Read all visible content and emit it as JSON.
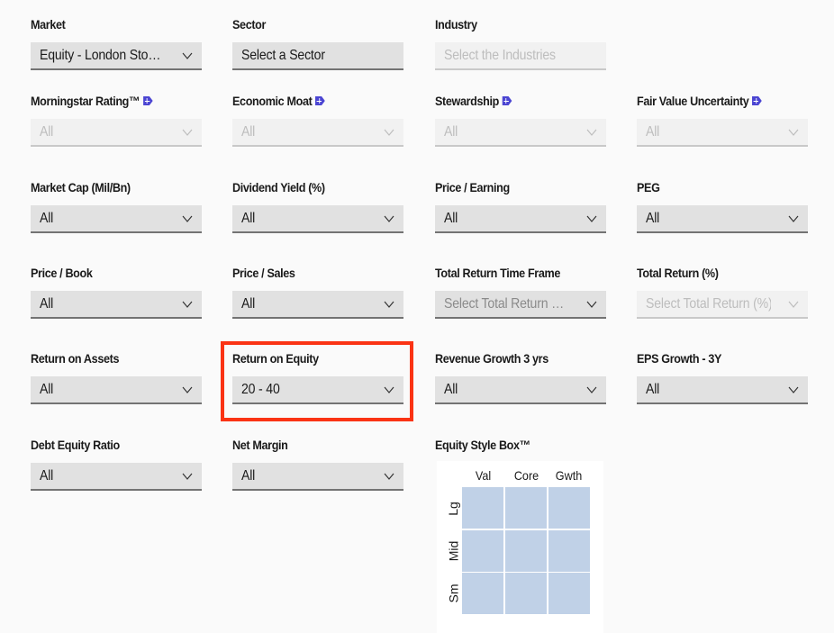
{
  "filters": {
    "market": {
      "label": "Market",
      "value": "Equity - London Sto…"
    },
    "sector": {
      "label": "Sector",
      "value": "Select a Sector"
    },
    "industry": {
      "label": "Industry",
      "placeholder": "Select the Industries"
    },
    "morningstar_rating": {
      "label": "Morningstar Rating™",
      "value": "All"
    },
    "economic_moat": {
      "label": "Economic Moat",
      "value": "All"
    },
    "stewardship": {
      "label": "Stewardship",
      "value": "All"
    },
    "fair_value_uncertainty": {
      "label": "Fair Value Uncertainty",
      "value": "All"
    },
    "market_cap": {
      "label": "Market Cap (Mil/Bn)",
      "value": "All"
    },
    "dividend_yield": {
      "label": "Dividend Yield (%)",
      "value": "All"
    },
    "price_earning": {
      "label": "Price / Earning",
      "value": "All"
    },
    "peg": {
      "label": "PEG",
      "value": "All"
    },
    "price_book": {
      "label": "Price / Book",
      "value": "All"
    },
    "price_sales": {
      "label": "Price / Sales",
      "value": "All"
    },
    "total_return_time_frame": {
      "label": "Total Return Time Frame",
      "placeholder": "Select Total Return …"
    },
    "total_return": {
      "label": "Total Return (%)",
      "placeholder": "Select Total Return (%)"
    },
    "return_on_assets": {
      "label": "Return on Assets",
      "value": "All"
    },
    "return_on_equity": {
      "label": "Return on Equity",
      "value": "20 - 40"
    },
    "revenue_growth_3yrs": {
      "label": "Revenue Growth 3 yrs",
      "value": "All"
    },
    "eps_growth_3y": {
      "label": "EPS Growth - 3Y",
      "value": "All"
    },
    "debt_equity_ratio": {
      "label": "Debt Equity Ratio",
      "value": "All"
    },
    "net_margin": {
      "label": "Net Margin",
      "value": "All"
    }
  },
  "style_box": {
    "label": "Equity Style Box™",
    "columns": [
      "Val",
      "Core",
      "Gwth"
    ],
    "rows": [
      "Lg",
      "Mid",
      "Sm"
    ]
  },
  "icons": {
    "premium_tag": "tag-plus-icon",
    "dropdown": "chevron-down-icon"
  },
  "colors": {
    "highlight": "#fa3314",
    "premium_tag": "#4b45d2",
    "style_box_cell": "#c0d1e7",
    "select_bg": "#e1e1e1",
    "select_disabled_bg": "#f1f1f1"
  }
}
